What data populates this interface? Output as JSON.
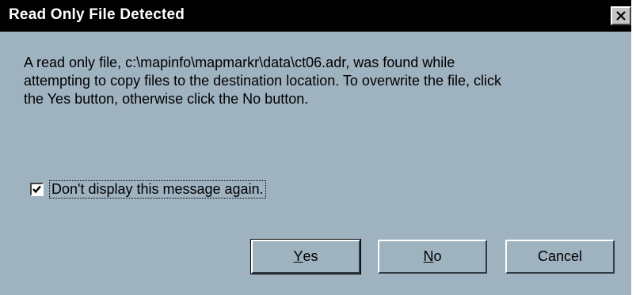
{
  "dialog": {
    "title": "Read Only File Detected",
    "message": "A read only file, c:\\mapinfo\\mapmarkr\\data\\ct06.adr, was found while\nattempting to copy files to the destination location. To overwrite the file, click\nthe Yes button,  otherwise click the No button.",
    "checkbox": {
      "label": "Don't display this message again.",
      "checked": true
    },
    "buttons": {
      "yes": {
        "mnemonic": "Y",
        "rest": "es"
      },
      "no": {
        "mnemonic": "N",
        "rest": "o"
      },
      "cancel": {
        "label": "Cancel"
      }
    }
  },
  "icons": {
    "close": "close-icon",
    "check": "checkmark-icon"
  },
  "colors": {
    "background": "#9fb2c0",
    "titlebar": "#000000",
    "title_text": "#ffffff"
  }
}
